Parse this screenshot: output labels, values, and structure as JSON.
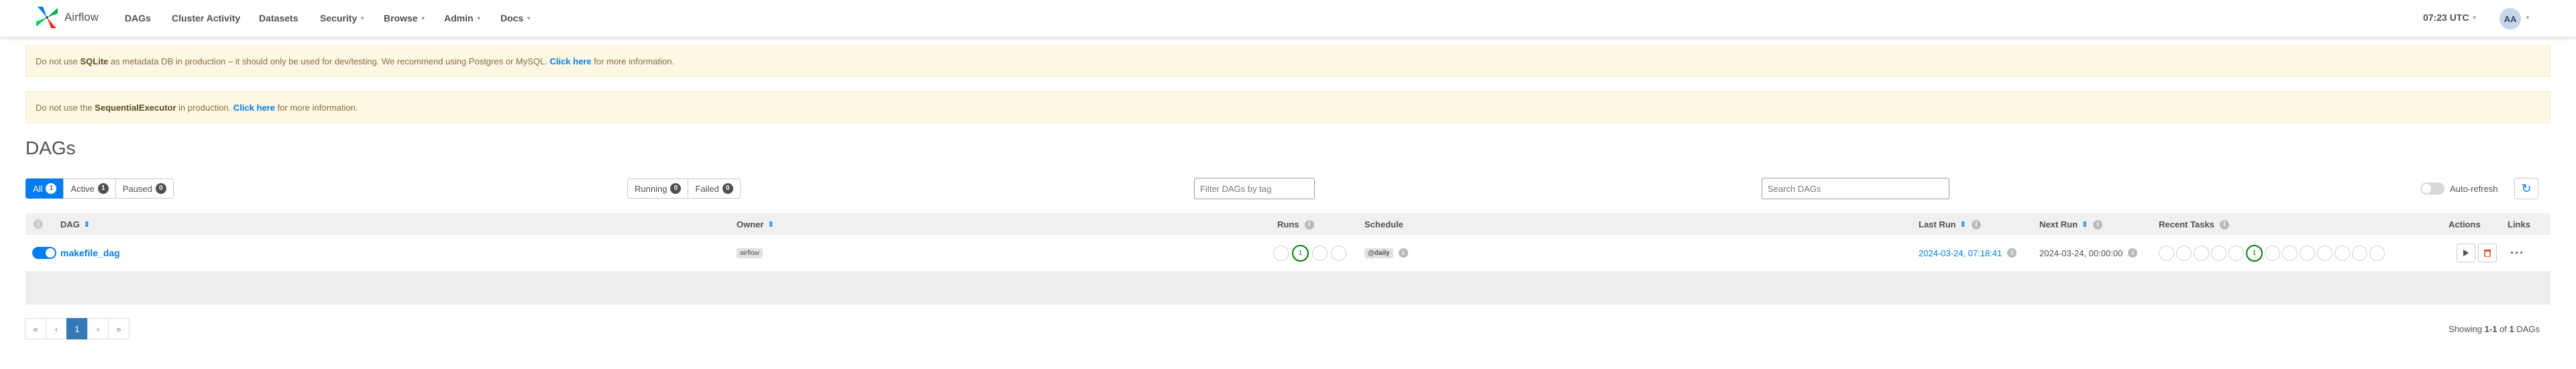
{
  "navbar": {
    "brand": "Airflow",
    "menu": [
      {
        "label": "DAGs",
        "dropdown": false
      },
      {
        "label": "Cluster Activity",
        "dropdown": false
      },
      {
        "label": "Datasets",
        "dropdown": false
      },
      {
        "label": "Security",
        "dropdown": true
      },
      {
        "label": "Browse",
        "dropdown": true
      },
      {
        "label": "Admin",
        "dropdown": true
      },
      {
        "label": "Docs",
        "dropdown": true
      }
    ],
    "time": "07:23 UTC",
    "user_initials": "AA"
  },
  "alerts": {
    "sqlite": {
      "part1": "Do not use ",
      "bold": "SQLite",
      "part2": " as metadata DB in production – it should only be used for dev/testing. We recommend using Postgres or MySQL. ",
      "link": "Click here",
      "part3": " for more information."
    },
    "executor": {
      "part1": "Do not use the ",
      "bold": "SequentialExecutor",
      "part2": " in production. ",
      "link": "Click here",
      "part3": " for more information."
    }
  },
  "page": {
    "title": "DAGs"
  },
  "filters": {
    "status": [
      {
        "label": "All",
        "count": "1",
        "active": true
      },
      {
        "label": "Active",
        "count": "1",
        "active": false
      },
      {
        "label": "Paused",
        "count": "0",
        "active": false
      }
    ],
    "runs": [
      {
        "label": "Running",
        "count": "0"
      },
      {
        "label": "Failed",
        "count": "0"
      }
    ],
    "tag_placeholder": "Filter DAGs by tag",
    "search_placeholder": "Search DAGs",
    "auto_refresh_label": "Auto-refresh"
  },
  "table": {
    "headers": {
      "dag": "DAG",
      "owner": "Owner",
      "runs": "Runs",
      "schedule": "Schedule",
      "last_run": "Last Run",
      "next_run": "Next Run",
      "recent_tasks": "Recent Tasks",
      "actions": "Actions",
      "links": "Links"
    },
    "rows": [
      {
        "dag_id": "makefile_dag",
        "paused": false,
        "owner": "airflow",
        "runs_success_count": "1",
        "schedule": "@daily",
        "last_run": "2024-03-24, 07:18:41",
        "next_run": "2024-03-24, 00:00:00",
        "recent_tasks_success_count": "1",
        "links_icon": "ellipsis-icon"
      }
    ]
  },
  "pagination": {
    "first": "«",
    "prev": "‹",
    "current": "1",
    "next": "›",
    "last": "»",
    "showing_prefix": "Showing ",
    "showing_range": "1-1",
    "showing_mid": " of ",
    "showing_total": "1",
    "showing_suffix": " DAGs"
  },
  "colors": {
    "accent": "#017cee",
    "success": "#008000",
    "alert_bg": "#fcf8e3",
    "delete": "#e43921"
  }
}
